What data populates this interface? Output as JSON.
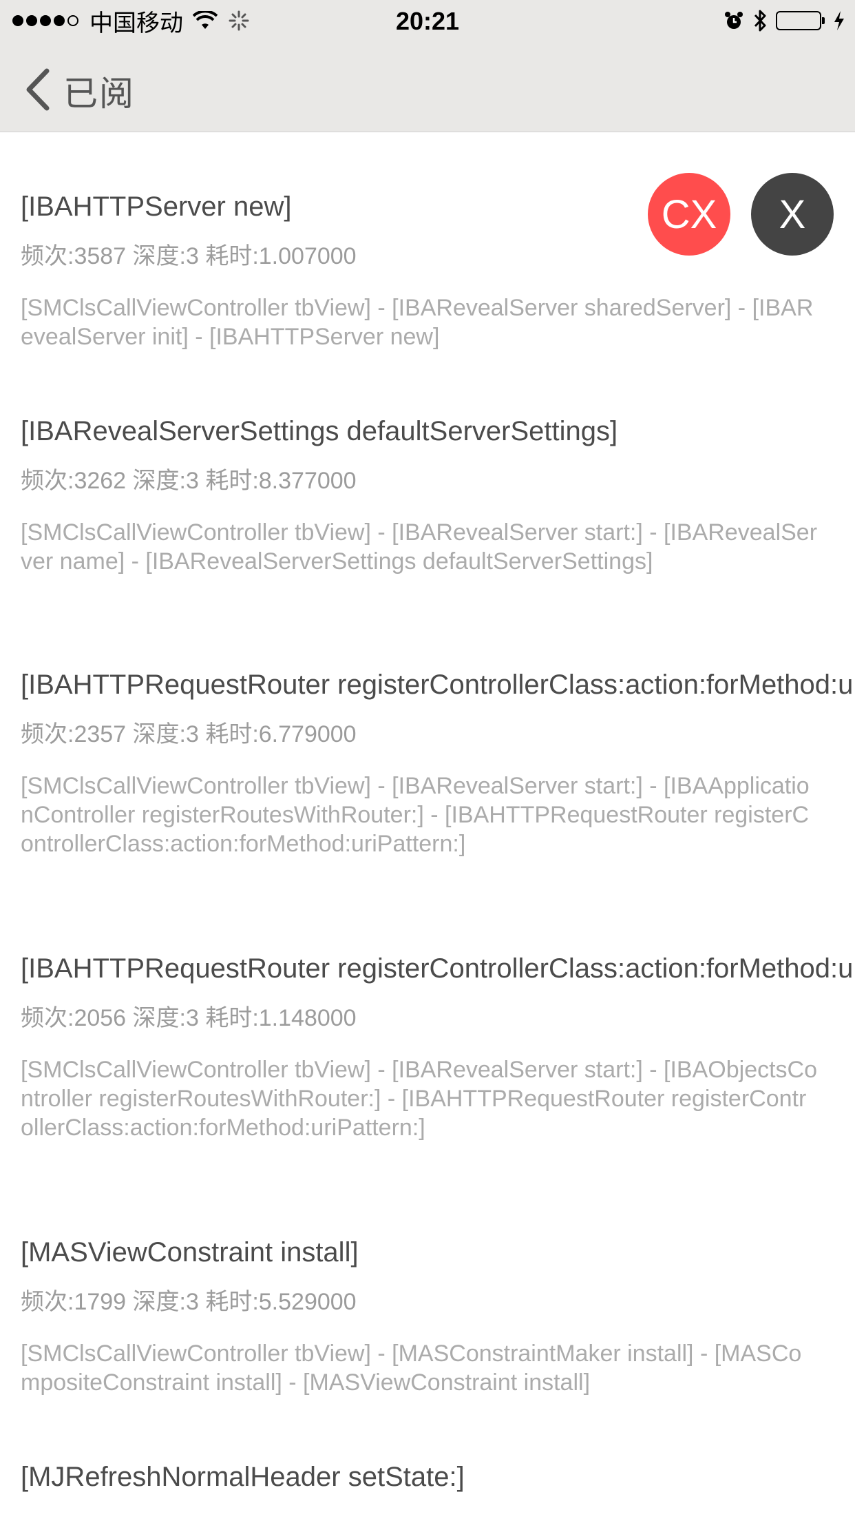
{
  "status_bar": {
    "carrier": "中国移动",
    "time": "20:21"
  },
  "nav": {
    "back_label": "已阅"
  },
  "buttons": {
    "cx_label": "CX",
    "x_label": "X"
  },
  "colors": {
    "cx_button": "#ff4d4d",
    "x_button": "#444444",
    "battery": "#4cd964"
  },
  "items": [
    {
      "title": "[IBAHTTPServer new]",
      "meta": "频次:3587 深度:3 耗时:1.007000",
      "stack": "[SMClsCallViewController tbView] - [IBARevealServer sharedServer] - [IBARevealServer init] - [IBAHTTPServer new]"
    },
    {
      "title": "[IBARevealServerSettings defaultServerSettings]",
      "meta": "频次:3262 深度:3 耗时:8.377000",
      "stack": "[SMClsCallViewController tbView] - [IBARevealServer start:] - [IBARevealServer name] - [IBARevealServerSettings defaultServerSettings]"
    },
    {
      "title": "[IBAHTTPRequestRouter registerControllerClass:action:forMethod:uriPattern:]",
      "meta": "频次:2357 深度:3 耗时:6.779000",
      "stack": "[SMClsCallViewController tbView] - [IBARevealServer start:] - [IBAApplicationController registerRoutesWithRouter:] - [IBAHTTPRequestRouter registerControllerClass:action:forMethod:uriPattern:]"
    },
    {
      "title": "[IBAHTTPRequestRouter registerControllerClass:action:forMethod:uriPattern:]",
      "meta": "频次:2056 深度:3 耗时:1.148000",
      "stack": "[SMClsCallViewController tbView] - [IBARevealServer start:] - [IBAObjectsController registerRoutesWithRouter:] - [IBAHTTPRequestRouter registerControllerClass:action:forMethod:uriPattern:]"
    },
    {
      "title": "[MASViewConstraint install]",
      "meta": "频次:1799 深度:3 耗时:5.529000",
      "stack": "[SMClsCallViewController tbView] - [MASConstraintMaker install] - [MASCompositeConstraint install] - [MASViewConstraint install]"
    },
    {
      "title": "[MJRefreshNormalHeader setState:]"
    }
  ]
}
